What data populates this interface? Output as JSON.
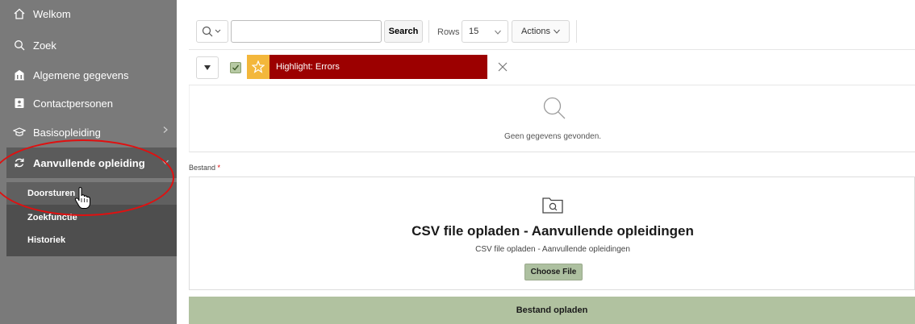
{
  "sidebar": {
    "items": [
      {
        "label": "Welkom",
        "icon": "home-icon"
      },
      {
        "label": "Zoek",
        "icon": "search-icon"
      },
      {
        "label": "Algemene gegevens",
        "icon": "building-icon"
      },
      {
        "label": "Contactpersonen",
        "icon": "contact-card-icon"
      },
      {
        "label": "Basisopleiding",
        "icon": "graduation-cap-icon"
      },
      {
        "label": "Aanvullende opleiding",
        "icon": "refresh-icon"
      }
    ],
    "subitems": [
      {
        "label": "Doorsturen"
      },
      {
        "label": "Zoekfunctie"
      },
      {
        "label": "Historiek"
      }
    ]
  },
  "toolbar": {
    "search_value": "",
    "search_label": "Search",
    "rows_label": "Rows",
    "rows_value": "15",
    "actions_label": "Actions"
  },
  "filter": {
    "highlight_label": "Highlight: Errors",
    "highlight_color": "#9c0000"
  },
  "report": {
    "empty_message": "Geen gegevens gevonden."
  },
  "upload": {
    "field_label": "Bestand",
    "required_marker": "*",
    "title": "CSV file opladen - Aanvullende opleidingen",
    "subtitle": "CSV file opladen - Aanvullende opleidingen",
    "choose_label": "Choose File",
    "submit_label": "Bestand opladen"
  },
  "colors": {
    "sidebar_bg": "#7a7a7a",
    "submenu_bg": "#4e4e4e",
    "accent_green": "#b1c2a0",
    "annotation_red": "#e01010"
  }
}
